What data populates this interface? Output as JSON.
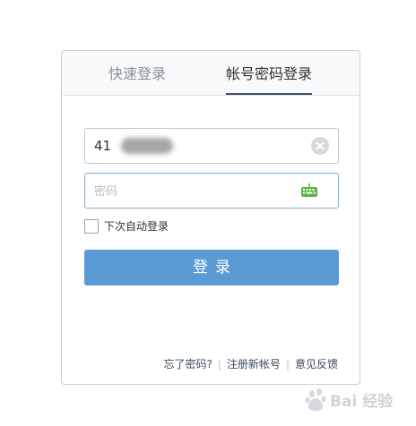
{
  "tabs": [
    {
      "label": "快速登录",
      "active": false
    },
    {
      "label": "帐号密码登录",
      "active": true
    }
  ],
  "username": {
    "value": "41"
  },
  "password": {
    "value": "",
    "placeholder": "密码"
  },
  "remember": {
    "label": "下次自动登录",
    "checked": false
  },
  "login_button": {
    "label": "登录"
  },
  "footer": {
    "forgot": "忘了密码?",
    "register": "注册新帐号",
    "feedback": "意见反馈",
    "separator": "|"
  },
  "watermark": {
    "text": "Bai 经验"
  },
  "colors": {
    "accent": "#5b9bd5",
    "keyboard_icon": "#5db54a",
    "tab_underline": "#3f4f63"
  },
  "icons": {
    "clear": "clear-icon",
    "keyboard": "keyboard-icon",
    "watermark": "baidu-logo"
  }
}
